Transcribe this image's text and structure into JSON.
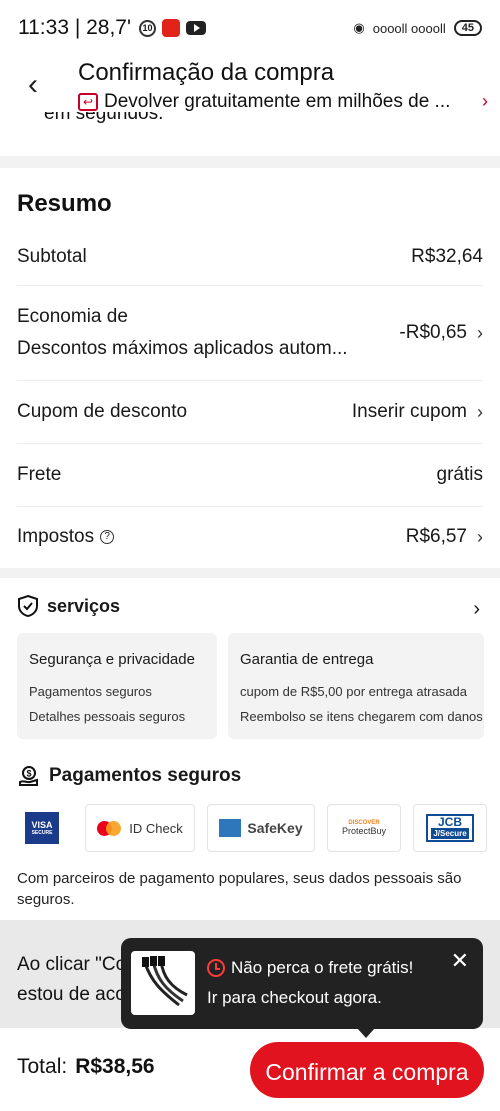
{
  "status_bar": {
    "time": "11:33 | 28,7'",
    "badge": "10",
    "signal": "ooooll ooooll",
    "battery": "45"
  },
  "header": {
    "title": "Confirmação da compra",
    "return_text": "Devolver gratuitamente em milhões de ...",
    "cut_text": "em segundos."
  },
  "summary": {
    "title": "Resumo",
    "subtotal_label": "Subtotal",
    "subtotal_value": "R$32,64",
    "economy_label": "Economia de",
    "economy_sub": "Descontos máximos aplicados autom...",
    "economy_value": "-R$0,65",
    "coupon_label": "Cupom de desconto",
    "coupon_value": "Inserir cupom",
    "shipping_label": "Frete",
    "shipping_value": "grátis",
    "taxes_label": "Impostos",
    "taxes_value": "R$6,57"
  },
  "services": {
    "title": "serviços",
    "cards": [
      {
        "title": "Segurança e privacidade",
        "line1": "Pagamentos seguros",
        "line2": "Detalhes pessoais seguros"
      },
      {
        "title": "Garantia de entrega",
        "line1": "cupom de R$5,00 por entrega atrasada",
        "line2": "Reembolso se itens chegarem com danos"
      }
    ]
  },
  "payments": {
    "title": "Pagamentos seguros",
    "visa": "VISA",
    "visa_sub": "SECURE",
    "mastercard": "ID Check",
    "safekey": "SafeKey",
    "discover": "DISCOVER",
    "protectbuy": "ProtectBuy",
    "jcb": "JCB",
    "jcb_sub": "J/Secure",
    "note": "Com parceiros de pagamento populares, seus dados pessoais são seguros."
  },
  "terms": {
    "text": "Ao clicar \"Confirmar a compra\", eu afirmo que li e estou de acordo com os termos e condições de uso..."
  },
  "toast": {
    "line1": "Não perca o frete grátis!",
    "line2": "Ir para checkout agora."
  },
  "footer": {
    "total_label": "Total:",
    "total_value": "R$38,56",
    "confirm_label": "Confirmar a compra"
  },
  "colors": {
    "accent": "#e1131e",
    "toast_bg": "#222222"
  }
}
